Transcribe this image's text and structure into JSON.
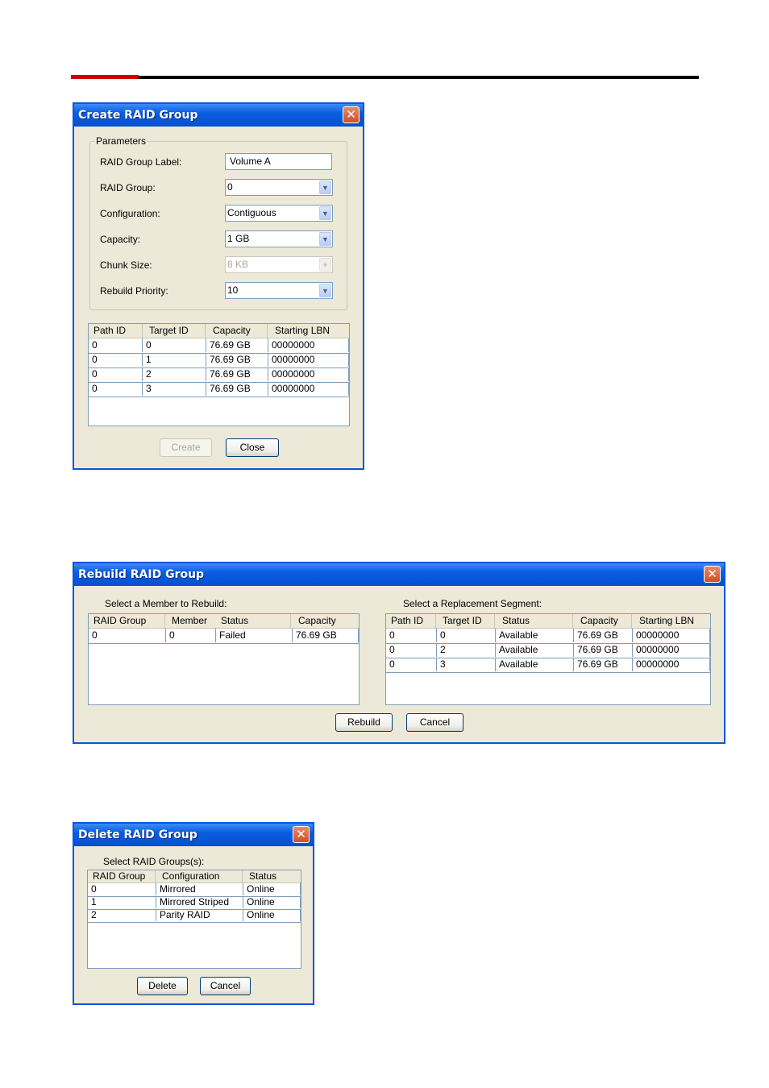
{
  "create_dialog": {
    "title": "Create RAID Group",
    "close_glyph": "✕",
    "parameters_label": "Parameters",
    "fields": {
      "label_label": "RAID Group Label:",
      "label_value": "Volume A",
      "group_label": "RAID Group:",
      "group_value": "0",
      "config_label": "Configuration:",
      "config_value": "Contiguous",
      "capacity_label": "Capacity:",
      "capacity_value": "1 GB",
      "chunk_label": "Chunk Size:",
      "chunk_value": "8 KB",
      "priority_label": "Rebuild Priority:",
      "priority_value": "10"
    },
    "columns": [
      "Path ID",
      "Target ID",
      "Capacity",
      "Starting LBN"
    ],
    "rows": [
      [
        "0",
        "0",
        "76.69 GB",
        "00000000"
      ],
      [
        "0",
        "1",
        "76.69 GB",
        "00000000"
      ],
      [
        "0",
        "2",
        "76.69 GB",
        "00000000"
      ],
      [
        "0",
        "3",
        "76.69 GB",
        "00000000"
      ]
    ],
    "create_button": "Create",
    "close_button": "Close"
  },
  "rebuild_dialog": {
    "title": "Rebuild RAID Group",
    "close_glyph": "✕",
    "member_caption": "Select a Member to Rebuild:",
    "member_columns": [
      "RAID Group",
      "Member",
      "Status",
      "Capacity"
    ],
    "member_rows": [
      [
        "0",
        "0",
        "Failed",
        "76.69 GB"
      ]
    ],
    "segment_caption": "Select a Replacement Segment:",
    "segment_columns": [
      "Path ID",
      "Target ID",
      "Status",
      "Capacity",
      "Starting LBN"
    ],
    "segment_rows": [
      [
        "0",
        "0",
        "Available",
        "76.69 GB",
        "00000000"
      ],
      [
        "0",
        "2",
        "Available",
        "76.69 GB",
        "00000000"
      ],
      [
        "0",
        "3",
        "Available",
        "76.69 GB",
        "00000000"
      ]
    ],
    "rebuild_button": "Rebuild",
    "cancel_button": "Cancel"
  },
  "delete_dialog": {
    "title": "Delete RAID Group",
    "close_glyph": "✕",
    "caption": "Select RAID Groups(s):",
    "columns": [
      "RAID Group",
      "Configuration",
      "Status"
    ],
    "rows": [
      [
        "0",
        "Mirrored",
        "Online"
      ],
      [
        "1",
        "Mirrored Striped",
        "Online"
      ],
      [
        "2",
        "Parity RAID",
        "Online"
      ]
    ],
    "delete_button": "Delete",
    "cancel_button": "Cancel"
  }
}
